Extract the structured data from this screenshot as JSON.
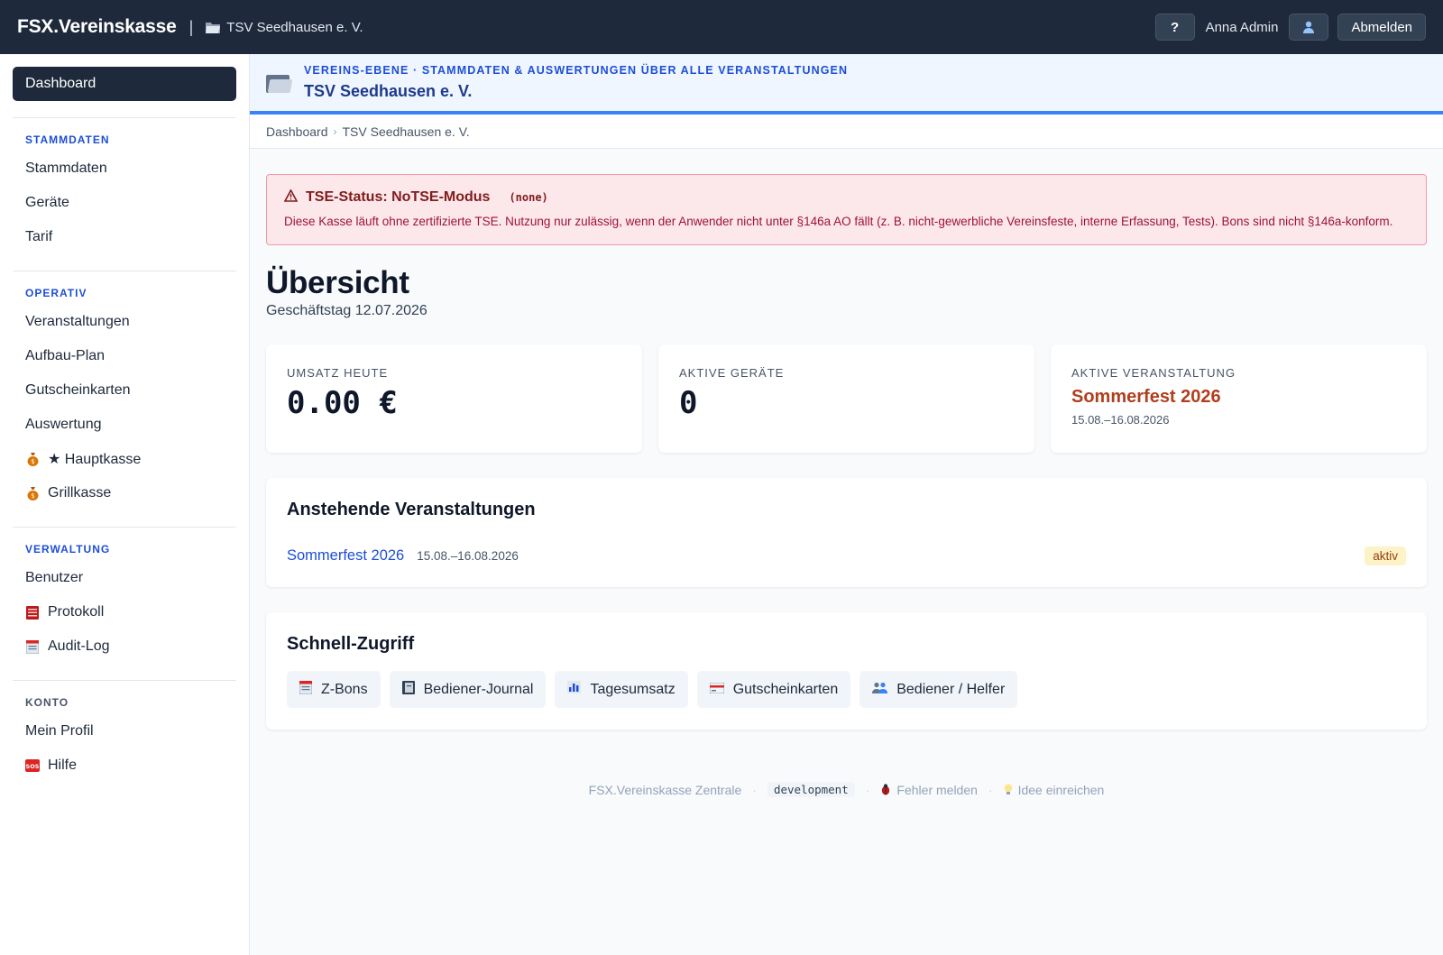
{
  "topbar": {
    "brand": "FSX.Vereinskasse",
    "separator": "|",
    "club_name": "TSV Seedhausen e. V.",
    "help_label": "?",
    "user_name": "Anna Admin",
    "logout_label": "Abmelden"
  },
  "sidebar": {
    "dashboard": "Dashboard",
    "sections": {
      "stammdaten": {
        "title": "STAMMDATEN",
        "items": [
          "Stammdaten",
          "Geräte",
          "Tarif"
        ]
      },
      "operativ": {
        "title": "OPERATIV",
        "items": [
          "Veranstaltungen",
          "Aufbau-Plan",
          "Gutscheinkarten",
          "Auswertung",
          "★ Hauptkasse",
          "Grillkasse"
        ]
      },
      "verwaltung": {
        "title": "VERWALTUNG",
        "items": [
          "Benutzer",
          "Protokoll",
          "Audit-Log"
        ]
      },
      "konto": {
        "title": "KONTO",
        "items": [
          "Mein Profil",
          "Hilfe"
        ]
      }
    }
  },
  "level": {
    "subtitle": "VEREINS-EBENE · STAMMDATEN & AUSWERTUNGEN ÜBER ALLE VERANSTALTUNGEN",
    "title": "TSV Seedhausen e. V."
  },
  "breadcrumb": [
    "Dashboard",
    "TSV Seedhausen e. V."
  ],
  "alert": {
    "title": "TSE-Status: NoTSE-Modus",
    "code": "(none)",
    "text": "Diese Kasse läuft ohne zertifizierte TSE. Nutzung nur zulässig, wenn der Anwender nicht unter §146a AO fällt (z. B. nicht-gewerbliche Vereinsfeste, interne Erfassung, Tests). Bons sind nicht §146a-konform."
  },
  "overview": {
    "title": "Übersicht",
    "business_day": "Geschäftstag 12.07.2026"
  },
  "cards": {
    "revenue": {
      "label": "UMSATZ HEUTE",
      "value": "0.00 €"
    },
    "devices": {
      "label": "AKTIVE GERÄTE",
      "value": "0"
    },
    "event": {
      "label": "AKTIVE VERANSTALTUNG",
      "name": "Sommerfest 2026",
      "dates": "15.08.–16.08.2026"
    }
  },
  "upcoming": {
    "title": "Anstehende Veranstaltungen",
    "events": [
      {
        "name": "Sommerfest 2026",
        "dates": "15.08.–16.08.2026",
        "status": "aktiv"
      }
    ]
  },
  "quick_access": {
    "title": "Schnell-Zugriff",
    "buttons": [
      "Z-Bons",
      "Bediener-Journal",
      "Tagesumsatz",
      "Gutscheinkarten",
      "Bediener / Helfer"
    ]
  },
  "footer": {
    "app": "FSX.Vereinskasse Zentrale",
    "env": "development",
    "bug": "Fehler melden",
    "idea": "Idee einreichen"
  },
  "colors": {
    "topbar": "#1e293b",
    "accent": "#1d4ed8",
    "event_accent": "#b13e1d",
    "alert_bg": "#fce7ea"
  },
  "icons": [
    "folder-icon",
    "user-icon",
    "money-bag-icon",
    "ledger-icon",
    "notepad-icon",
    "sos-icon",
    "warning-icon",
    "book-icon",
    "bar-chart-icon",
    "card-icon",
    "people-icon",
    "bug-icon",
    "lightbulb-icon"
  ]
}
